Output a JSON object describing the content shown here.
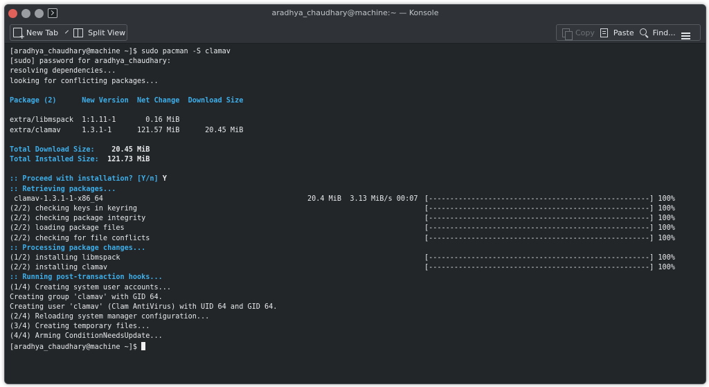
{
  "window": {
    "title": "aradhya_chaudhary@machine:~ — Konsole"
  },
  "toolbar": {
    "new_tab": "New Tab",
    "split_view": "Split View",
    "copy": "Copy",
    "paste": "Paste",
    "find": "Find..."
  },
  "terminal": {
    "lines": [
      {
        "type": "text",
        "text": "[aradhya_chaudhary@machine ~]$ sudo pacman -S clamav"
      },
      {
        "type": "text",
        "text": "[sudo] password for aradhya_chaudhary:"
      },
      {
        "type": "text",
        "text": "resolving dependencies..."
      },
      {
        "type": "text",
        "text": "looking for conflicting packages..."
      },
      {
        "type": "blank"
      },
      {
        "type": "header",
        "text": "Package (2)      New Version  Net Change  Download Size"
      },
      {
        "type": "blank"
      },
      {
        "type": "text",
        "text": "extra/libmspack  1:1.11-1       0.16 MiB"
      },
      {
        "type": "text",
        "text": "extra/clamav     1.3.1-1      121.57 MiB      20.45 MiB"
      },
      {
        "type": "blank"
      },
      {
        "type": "label",
        "label": "Total Download Size:",
        "value": "    20.45 MiB"
      },
      {
        "type": "label",
        "label": "Total Installed Size:",
        "value": "  121.73 MiB"
      },
      {
        "type": "blank"
      },
      {
        "type": "label",
        "label": ":: Proceed with installation? [Y/n]",
        "value": " Y"
      },
      {
        "type": "header",
        "text": ":: Retrieving packages..."
      },
      {
        "type": "progress",
        "text": " clamav-1.3.1-1-x86_64",
        "stats": "20.4 MiB  3.13 MiB/s 00:07",
        "bar": "[----------------------------------------------------] 100%"
      },
      {
        "type": "progress",
        "text": "(2/2) checking keys in keyring",
        "stats": "",
        "bar": "[----------------------------------------------------] 100%"
      },
      {
        "type": "progress",
        "text": "(2/2) checking package integrity",
        "stats": "",
        "bar": "[----------------------------------------------------] 100%"
      },
      {
        "type": "progress",
        "text": "(2/2) loading package files",
        "stats": "",
        "bar": "[----------------------------------------------------] 100%"
      },
      {
        "type": "progress",
        "text": "(2/2) checking for file conflicts",
        "stats": "",
        "bar": "[----------------------------------------------------] 100%"
      },
      {
        "type": "header",
        "text": ":: Processing package changes..."
      },
      {
        "type": "progress",
        "text": "(1/2) installing libmspack",
        "stats": "",
        "bar": "[----------------------------------------------------] 100%"
      },
      {
        "type": "progress",
        "text": "(2/2) installing clamav",
        "stats": "",
        "bar": "[----------------------------------------------------] 100%"
      },
      {
        "type": "header",
        "text": ":: Running post-transaction hooks..."
      },
      {
        "type": "text",
        "text": "(1/4) Creating system user accounts..."
      },
      {
        "type": "text",
        "text": "Creating group 'clamav' with GID 64."
      },
      {
        "type": "text",
        "text": "Creating user 'clamav' (Clam AntiVirus) with UID 64 and GID 64."
      },
      {
        "type": "text",
        "text": "(2/4) Reloading system manager configuration..."
      },
      {
        "type": "text",
        "text": "(3/4) Creating temporary files..."
      },
      {
        "type": "text",
        "text": "(4/4) Arming ConditionNeedsUpdate..."
      },
      {
        "type": "prompt",
        "text": "[aradhya_chaudhary@machine ~]$"
      }
    ]
  }
}
